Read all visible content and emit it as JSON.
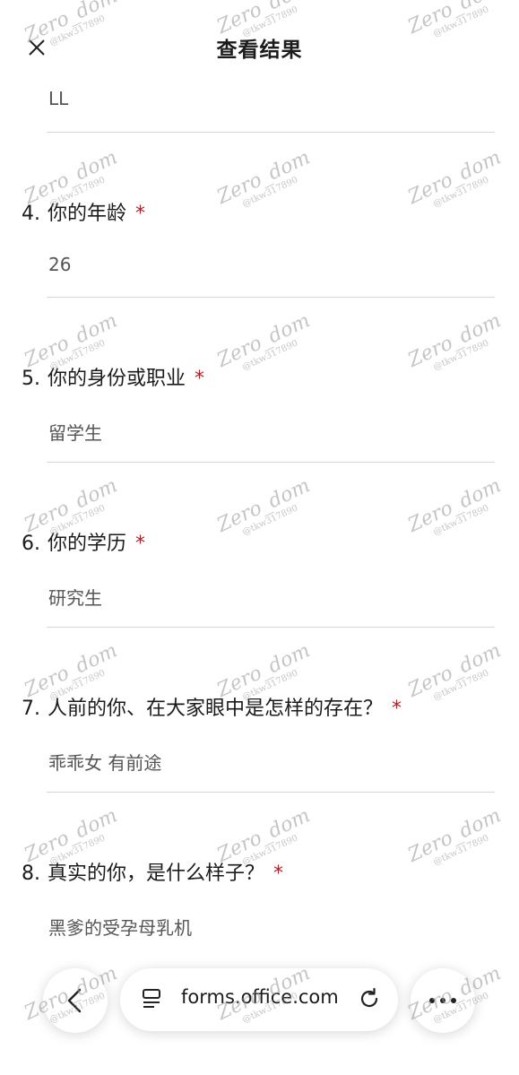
{
  "header": {
    "title": "查看结果",
    "close_icon": "close-icon"
  },
  "prev_answer": "LL",
  "questions": [
    {
      "number": "4.",
      "text": "你的年龄",
      "required": "*",
      "answer": "26"
    },
    {
      "number": "5.",
      "text": "你的身份或职业",
      "required": "*",
      "answer": "留学生"
    },
    {
      "number": "6.",
      "text": "你的学历",
      "required": "*",
      "answer": "研究生"
    },
    {
      "number": "7.",
      "text": "人前的你、在大家眼中是怎样的存在？",
      "required": "*",
      "answer": "乖乖女 有前途"
    },
    {
      "number": "8.",
      "text": "真实的你，是什么样子？",
      "required": "*",
      "answer": "黑爹的受孕母乳机"
    }
  ],
  "browser": {
    "url": "forms.office.com",
    "back_icon": "back-chevron-icon",
    "tabs_icon": "tabs-icon",
    "reload_icon": "reload-icon",
    "more_icon": "more-dots-icon"
  },
  "watermark": {
    "main": "Zero_dom",
    "sub": "@tkw317890"
  },
  "colors": {
    "required": "#a4262c",
    "answer_text": "#555555",
    "divider": "#d6d6d6"
  }
}
